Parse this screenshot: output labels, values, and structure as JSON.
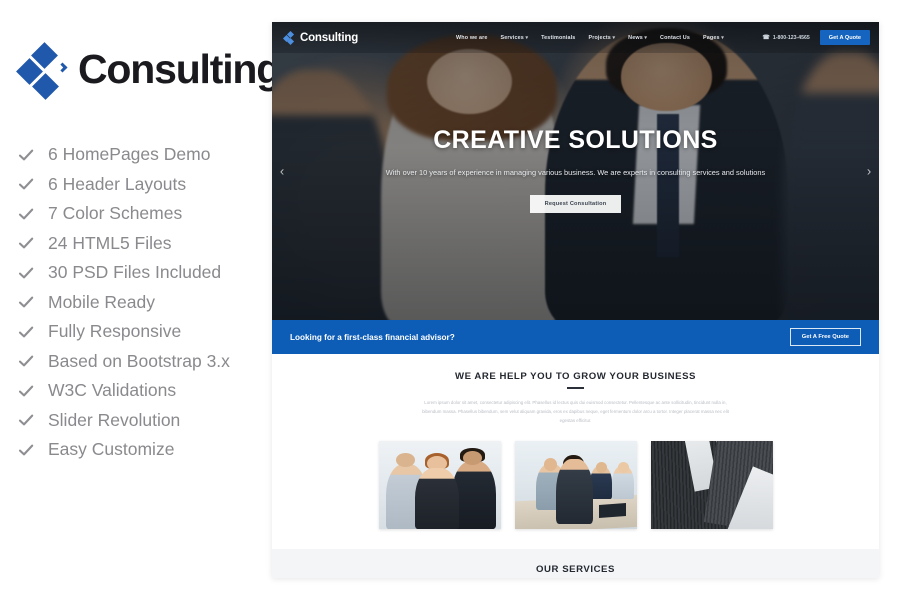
{
  "left_panel": {
    "brand": {
      "name": "Consulting",
      "mark_icon": "diamond-cluster-logo-icon",
      "accent_color": "#2058ab"
    },
    "features": [
      {
        "icon": "check-icon",
        "label": "6 HomePages Demo"
      },
      {
        "icon": "check-icon",
        "label": "6 Header Layouts"
      },
      {
        "icon": "check-icon",
        "label": "7 Color Schemes"
      },
      {
        "icon": "check-icon",
        "label": "24 HTML5 Files"
      },
      {
        "icon": "check-icon",
        "label": "30 PSD Files Included"
      },
      {
        "icon": "check-icon",
        "label": "Mobile Ready"
      },
      {
        "icon": "check-icon",
        "label": "Fully Responsive"
      },
      {
        "icon": "check-icon",
        "label": "Based on Bootstrap 3.x"
      },
      {
        "icon": "check-icon",
        "label": "W3C Validations"
      },
      {
        "icon": "check-icon",
        "label": "Slider Revolution"
      },
      {
        "icon": "check-icon",
        "label": "Easy Customize"
      }
    ]
  },
  "preview": {
    "navbar": {
      "brand": "Consulting",
      "brand_mark_icon": "diamond-cluster-logo-icon",
      "menu": [
        {
          "label": "Who we are",
          "has_caret": false
        },
        {
          "label": "Services",
          "has_caret": true
        },
        {
          "label": "Testimonials",
          "has_caret": false
        },
        {
          "label": "Projects",
          "has_caret": true
        },
        {
          "label": "News",
          "has_caret": true
        },
        {
          "label": "Contact Us",
          "has_caret": false
        },
        {
          "label": "Pages",
          "has_caret": true
        }
      ],
      "phone": "1-800-123-4565",
      "phone_icon": "phone-icon",
      "quote_button": "Get A Quote",
      "quote_button_color": "#1565c0"
    },
    "hero": {
      "title": "CREATIVE SOLUTIONS",
      "subtitle": "With over 10 years of experience in managing various business. We are experts in consulting services and solutions",
      "button": "Request Consultation",
      "arrow_prev": "‹",
      "arrow_next": "›"
    },
    "cta_bar": {
      "text": "Looking for a first-class financial advisor?",
      "button": "Get A Free Quote",
      "background_color": "#0d5cb6"
    },
    "grow_section": {
      "title": "WE ARE HELP YOU TO GROW YOUR BUSINESS",
      "paragraph": "Lorem ipsum dolor sit amet, consectetur adipiscing elit. Phasellus id lectus quis dui euismod consectetur. Pellentesque ac ante sollicitudin, tincidunt nulla in, bibendum massa. Phasellus bibendum, sem velut aliquam gravida, eros ex dapibus neque, eget fermentum dolor arcu a tortor. Integer placerat massa nec elit egestas efficitur.",
      "thumbnails": [
        {
          "alt": "business-team-photo"
        },
        {
          "alt": "meeting-room-photo"
        },
        {
          "alt": "skyscraper-architecture-photo"
        }
      ]
    },
    "services_section": {
      "title": "OUR SERVICES",
      "divider_color": "#1565c0"
    }
  }
}
